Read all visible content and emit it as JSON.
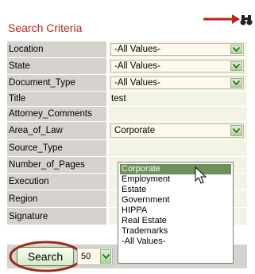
{
  "header": {
    "title": "Search Criteria",
    "search_icon": "binoculars-icon"
  },
  "fields": [
    {
      "label": "Location",
      "type": "select",
      "value": "-All Values-"
    },
    {
      "label": "State",
      "type": "select",
      "value": "-All Values-"
    },
    {
      "label": "Document_Type",
      "type": "select",
      "value": "-All Values-"
    },
    {
      "label": "Title",
      "type": "text",
      "value": "test"
    },
    {
      "label": "Attorney_Comments",
      "type": "text",
      "value": ""
    },
    {
      "label": "Area_of_Law",
      "type": "select",
      "value": "Corporate"
    },
    {
      "label": "Source_Type",
      "type": "text",
      "value": ""
    },
    {
      "label": "Number_of_Pages",
      "type": "text",
      "value": ""
    },
    {
      "label": "Execution",
      "type": "text",
      "value": ""
    },
    {
      "label": "Region",
      "type": "text",
      "value": ""
    },
    {
      "label": "Signature",
      "type": "text",
      "value": ""
    }
  ],
  "dropdown": {
    "options": [
      "Corporate",
      "Employment",
      "Estate",
      "Government",
      "HIPPA",
      "Real Estate",
      "Trademarks",
      "-All Values-"
    ],
    "selected": "Corporate"
  },
  "footer": {
    "search_label": "Search",
    "count_value": "50"
  },
  "colors": {
    "title": "#b5261e",
    "arrow": "#b5261e",
    "highlight": "#6d8f5b",
    "label_bg": "#d6d3ce",
    "value_bg": "#f4f4e4"
  }
}
